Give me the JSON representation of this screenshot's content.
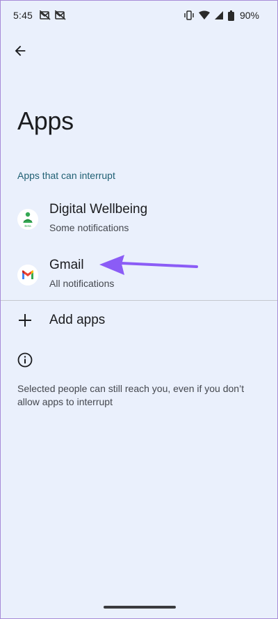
{
  "status_bar": {
    "time": "5:45",
    "battery": "90%",
    "left_icons": [
      "mail-off-icon",
      "mail-off-icon"
    ],
    "right_icons": [
      "vibrate-icon",
      "wifi-icon",
      "signal-icon",
      "battery-icon"
    ]
  },
  "header": {
    "back_icon": "arrow-back-icon",
    "title": "Apps"
  },
  "section": {
    "header": "Apps that can interrupt"
  },
  "apps": [
    {
      "name": "Digital Wellbeing",
      "subtitle": "Some notifications",
      "icon": "digital-wellbeing-icon",
      "icon_caption": "Beta"
    },
    {
      "name": "Gmail",
      "subtitle": "All notifications",
      "icon": "gmail-icon"
    }
  ],
  "add_apps": {
    "label": "Add apps",
    "icon": "plus-icon"
  },
  "info": {
    "icon": "info-icon",
    "text": "Selected people can still reach you, even if you don’t allow apps to interrupt"
  },
  "colors": {
    "background": "#eaf0fc",
    "section_header": "#1f5f73",
    "annotation_arrow": "#8b5cf6"
  }
}
